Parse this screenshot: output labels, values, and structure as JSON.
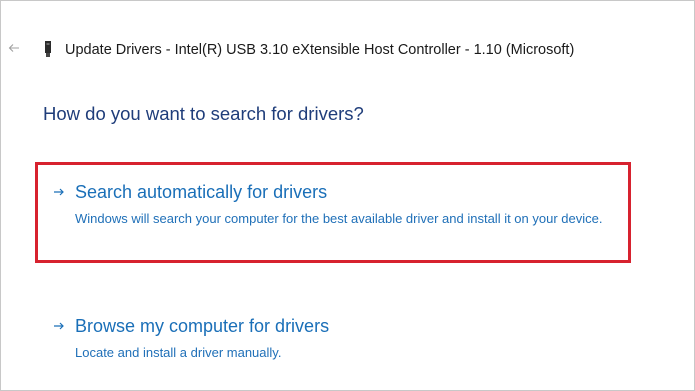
{
  "window": {
    "title": "Update Drivers - Intel(R) USB 3.10 eXtensible Host Controller - 1.10 (Microsoft)",
    "back_icon": "back-arrow-icon",
    "device_icon": "usb-device-icon"
  },
  "main": {
    "question": "How do you want to search for drivers?",
    "options": [
      {
        "title": "Search automatically for drivers",
        "description": "Windows will search your computer for the best available driver and install it on your device.",
        "highlighted": true,
        "icon": "arrow-right-icon"
      },
      {
        "title": "Browse my computer for drivers",
        "description": "Locate and install a driver manually.",
        "highlighted": false,
        "icon": "arrow-right-icon"
      }
    ]
  },
  "colors": {
    "question": "#1f3d7a",
    "link": "#1a6fb8",
    "highlight_border": "#d7222f",
    "title_text": "#1a1a1a"
  }
}
